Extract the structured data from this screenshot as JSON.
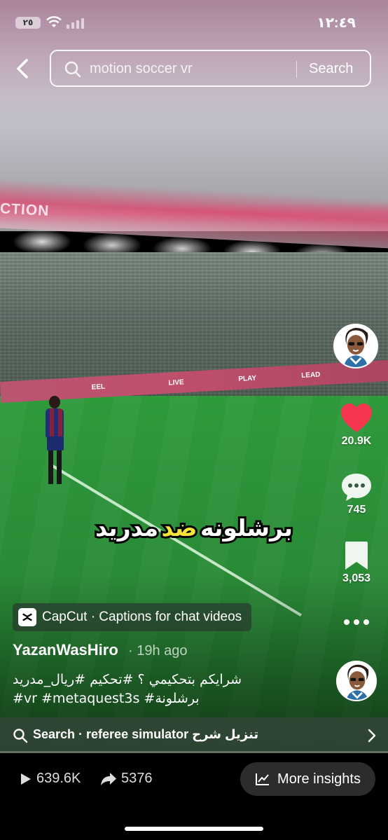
{
  "status_bar": {
    "battery_level": "٢٥",
    "time": "١٢:٤٩"
  },
  "search": {
    "query": "motion soccer vr",
    "button_label": "Search"
  },
  "video": {
    "caption_overlay": {
      "part1": "برشلونه",
      "part2_highlight": "ضد",
      "part3": "مدريد"
    },
    "stadium_signs": [
      "CTION",
      "EEL",
      "LIVE",
      "PLAY",
      "LEAD"
    ]
  },
  "actions": {
    "likes": "20.9K",
    "comments": "745",
    "saves": "3,053"
  },
  "anchor": {
    "text": "CapCut · Captions for chat videos"
  },
  "post": {
    "username": "YazanWasHiro",
    "time": "· 19h ago",
    "description_line1": "شرايكم بتحكيمي ؟ #تحكيم #ريال_مدريد",
    "description_line2": "#vr #metaquest3s #برشلونة"
  },
  "search_suggestion": {
    "text": "Search · referee simulator تنزيل شرح"
  },
  "bottom_bar": {
    "plays": "639.6K",
    "shares": "5376",
    "insights_label": "More insights"
  },
  "colors": {
    "like_red": "#f6364f",
    "caption_yellow": "#f7e43a",
    "pitch_green": "#2a8d37"
  }
}
